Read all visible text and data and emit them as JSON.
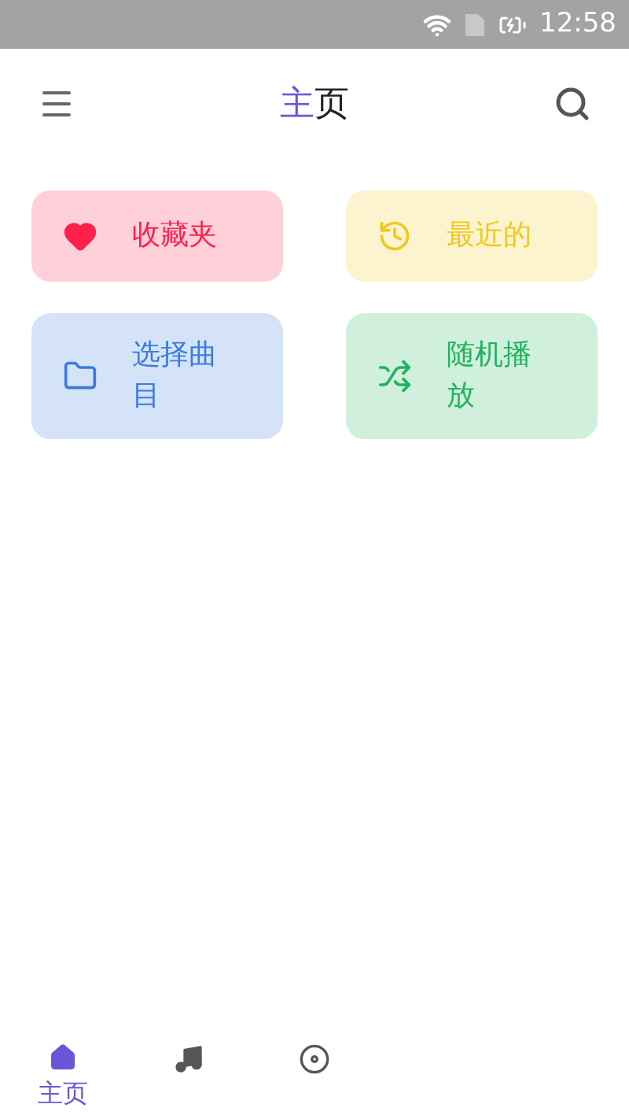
{
  "status_bar": {
    "time": "12:58"
  },
  "header": {
    "title_accent": "主",
    "title_rest": "页"
  },
  "cards": [
    {
      "kind": "heart",
      "label": "收藏夹",
      "color": "#ff1f4b"
    },
    {
      "kind": "history",
      "label": "最近的",
      "color": "#f2c81e"
    },
    {
      "kind": "folder",
      "label": "选择曲目",
      "color": "#3b7be0"
    },
    {
      "kind": "shuffle",
      "label": "随机播放",
      "color": "#1fb35c"
    }
  ],
  "bottom_nav": [
    {
      "kind": "home",
      "label": "主页",
      "selected": true
    },
    {
      "kind": "music",
      "selected": false
    },
    {
      "kind": "disc",
      "selected": false
    }
  ]
}
